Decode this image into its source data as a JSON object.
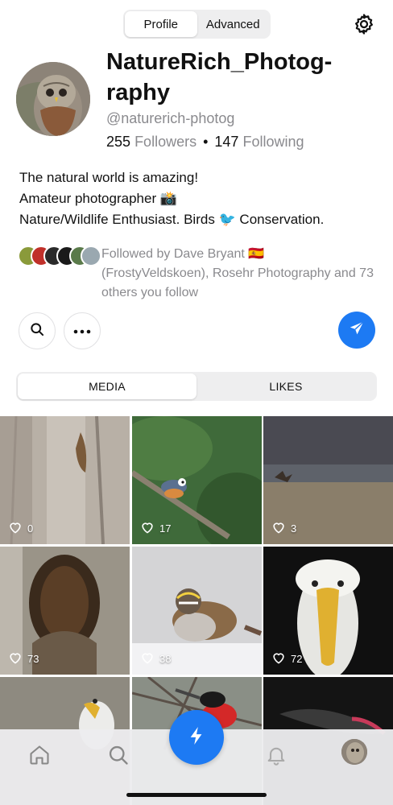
{
  "top_segment": {
    "profile_label": "Profile",
    "advanced_label": "Advanced",
    "active": "Profile"
  },
  "profile": {
    "display_name": "NatureRich_Photog-raphy",
    "handle": "@naturerich-photog",
    "followers_count": "255",
    "followers_label": "Followers",
    "following_count": "147",
    "following_label": "Following",
    "bio_lines": [
      "The natural world is amazing!",
      "Amateur photographer 📸",
      "Nature/Wildlife Enthusiast. Birds 🐦 Conservation."
    ],
    "followed_by": "Followed by Dave Bryant 🇪🇸 (FrostyVeldskoen), Rosehr Photography and 73 others you follow"
  },
  "content_tabs": {
    "media_label": "MEDIA",
    "likes_label": "LIKES",
    "active": "MEDIA"
  },
  "media": [
    {
      "likes": "0",
      "subject": "tree bark with knot"
    },
    {
      "likes": "17",
      "subject": "nuthatch on branch"
    },
    {
      "likes": "3",
      "subject": "bird in flight over field"
    },
    {
      "likes": "73",
      "subject": "hollow tree trunk"
    },
    {
      "likes": "38",
      "subject": "white-throated sparrow in snow"
    },
    {
      "likes": "72",
      "subject": "albatross portrait"
    },
    {
      "likes": "",
      "subject": "albatross"
    },
    {
      "likes": "",
      "subject": "frigatebird"
    },
    {
      "likes": "",
      "subject": "bird on dark background"
    }
  ],
  "icons": {
    "settings": "gear-icon",
    "search": "search-icon",
    "more": "ellipsis-icon",
    "message": "paper-plane-icon",
    "like": "heart-icon",
    "home": "home-icon",
    "compose": "lightning-icon",
    "notifications": "bell-icon"
  },
  "colors": {
    "accent": "#1d7af3",
    "muted_text": "#8a8a8e",
    "segment_bg": "#eeeeef"
  }
}
